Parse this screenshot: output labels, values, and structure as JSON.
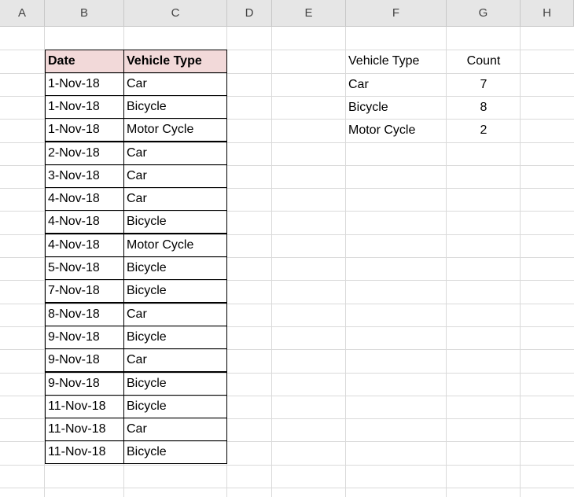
{
  "columns": [
    "A",
    "B",
    "C",
    "D",
    "E",
    "F",
    "G",
    "H"
  ],
  "table": {
    "headers": [
      "Date",
      "Vehicle Type"
    ],
    "rows": [
      [
        "1-Nov-18",
        "Car"
      ],
      [
        "1-Nov-18",
        "Bicycle"
      ],
      [
        "1-Nov-18",
        "Motor Cycle"
      ],
      [
        "2-Nov-18",
        "Car"
      ],
      [
        "3-Nov-18",
        "Car"
      ],
      [
        "4-Nov-18",
        "Car"
      ],
      [
        "4-Nov-18",
        "Bicycle"
      ],
      [
        "4-Nov-18",
        "Motor Cycle"
      ],
      [
        "5-Nov-18",
        "Bicycle"
      ],
      [
        "7-Nov-18",
        "Bicycle"
      ],
      [
        "8-Nov-18",
        "Car"
      ],
      [
        "9-Nov-18",
        "Bicycle"
      ],
      [
        "9-Nov-18",
        "Car"
      ],
      [
        "9-Nov-18",
        "Bicycle"
      ],
      [
        "11-Nov-18",
        "Bicycle"
      ],
      [
        "11-Nov-18",
        "Car"
      ],
      [
        "11-Nov-18",
        "Bicycle"
      ]
    ]
  },
  "summary": {
    "headers": [
      "Vehicle Type",
      "Count"
    ],
    "rows": [
      [
        "Car",
        "7"
      ],
      [
        "Bicycle",
        "8"
      ],
      [
        "Motor Cycle",
        "2"
      ]
    ]
  },
  "colors": {
    "header_fill": "#f2d9d9",
    "column_header_bg": "#e6e6e6",
    "gridline": "#dadada"
  }
}
